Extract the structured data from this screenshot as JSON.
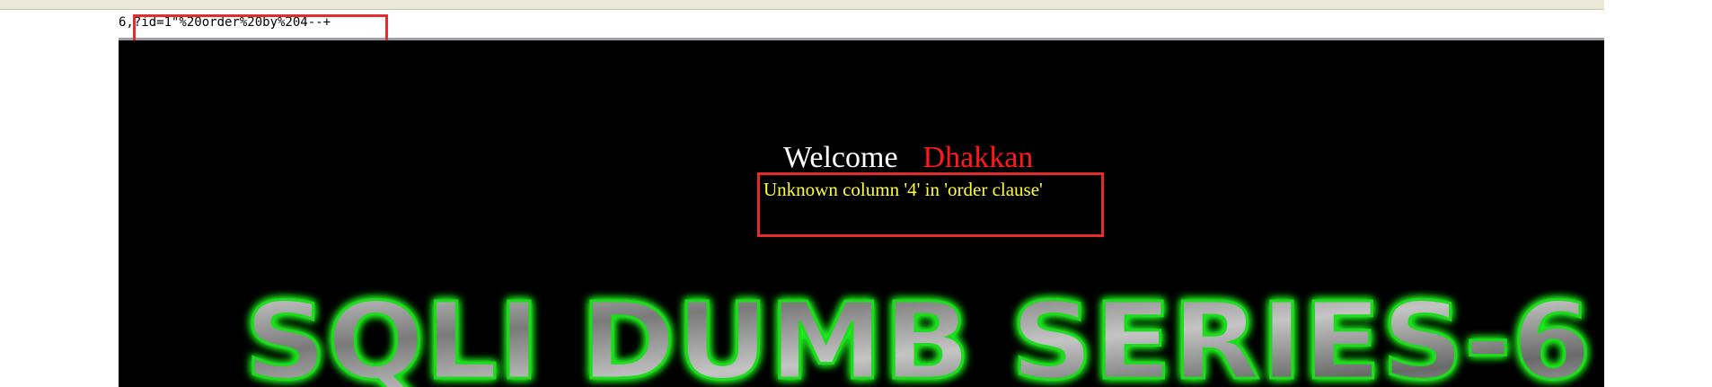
{
  "browser": {
    "url_fragment": "6,?id=1\"%20order%20by%204--+"
  },
  "page": {
    "welcome_label": "Welcome",
    "username": "Dhakkan",
    "error_message": "Unknown column '4' in 'order clause'",
    "banner_title": "SQLI DUMB SERIES-6"
  },
  "colors": {
    "page_background": "#000000",
    "welcome_text": "#ffffff",
    "username_text": "#ff1a1a",
    "error_text": "#ffff33",
    "banner_glow": "#22ff22",
    "annotation_box": "#e52b2b"
  }
}
